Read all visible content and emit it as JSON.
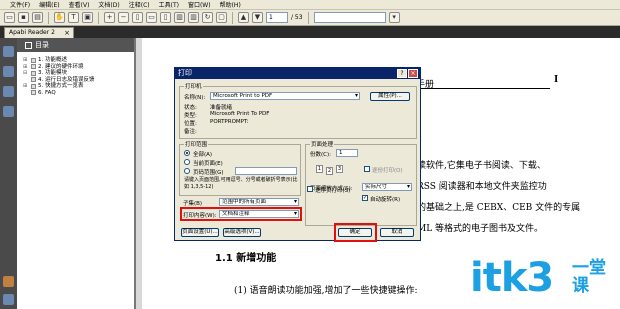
{
  "menubar": {
    "items": [
      "文件(F)",
      "编辑(E)",
      "查看(V)",
      "文档(D)",
      "注释(C)",
      "工具(T)",
      "窗口(W)",
      "帮助(H)"
    ]
  },
  "toolbar": {
    "page_current": "1",
    "page_total": "/ 53"
  },
  "tab": {
    "title": "Apabi Reader 2",
    "close": "×"
  },
  "nav": {
    "title": "目录",
    "items": [
      "1.  功能概述",
      "2.  建议的硬件环境",
      "3.  功能模块",
      "4.  运行日志及错误反馈",
      "5.  快捷方式一览表",
      "6.  FAQ"
    ],
    "toggles": [
      "⊞",
      "⊞",
      "⊟",
      "",
      "⊞",
      ""
    ]
  },
  "doc": {
    "header_text": "手册",
    "page_number": "I",
    "line1": "读软件,它集电子书阅读、下载、",
    "line2": "RSS 阅读器和本地文件夹监控功",
    "line3": "的基础之上,是 CEBX、CEB 文件的专属",
    "line4": "ML 等格式的电子图书及文件。",
    "heading": "1.1  新增功能",
    "line5": "(1) 语音朗读功能加强,增加了一些快捷键操作:"
  },
  "watermark": {
    "main": "itk3",
    "side": "一堂课"
  },
  "dialog": {
    "title": "打印",
    "printer_group": "打印机",
    "name_label": "名称(N):",
    "printer_name": "Microsoft Print to PDF",
    "properties_button": "属性(P)...",
    "status_label": "状态:",
    "status_value": "准备就绪",
    "type_label": "类型:",
    "type_value": "Microsoft Print To PDF",
    "where_label": "位置:",
    "where_value": "PORTPROMPT:",
    "comment_label": "备注:",
    "range_group": "打印范围",
    "range_all": "全部(A)",
    "range_current": "当前页面(E)",
    "range_pages": "页码范围(G)",
    "range_hint": "请键入页面范围,可用逗号、分号或者破折号表示(比如 1,3,5-12)",
    "subset_label": "子集(B)",
    "subset_value": "范围中的所有页面",
    "content_label": "打印内容(W):",
    "content_value": "文档和注释",
    "handling_group": "页面处理",
    "copies_label": "份数(C):",
    "copies_value": "1",
    "collate_label": "逐份打印(O)",
    "scaling_label": "页面缩放方式(S):",
    "scaling_value": "实际尺寸",
    "autorotate_label": "自动旋转(R)",
    "reverse_label": "逆序页打印(S)",
    "page_setup_button": "页面设置(U)...",
    "advanced_button": "高级选项(V)...",
    "ok_button": "确定",
    "cancel_button": "取消"
  }
}
